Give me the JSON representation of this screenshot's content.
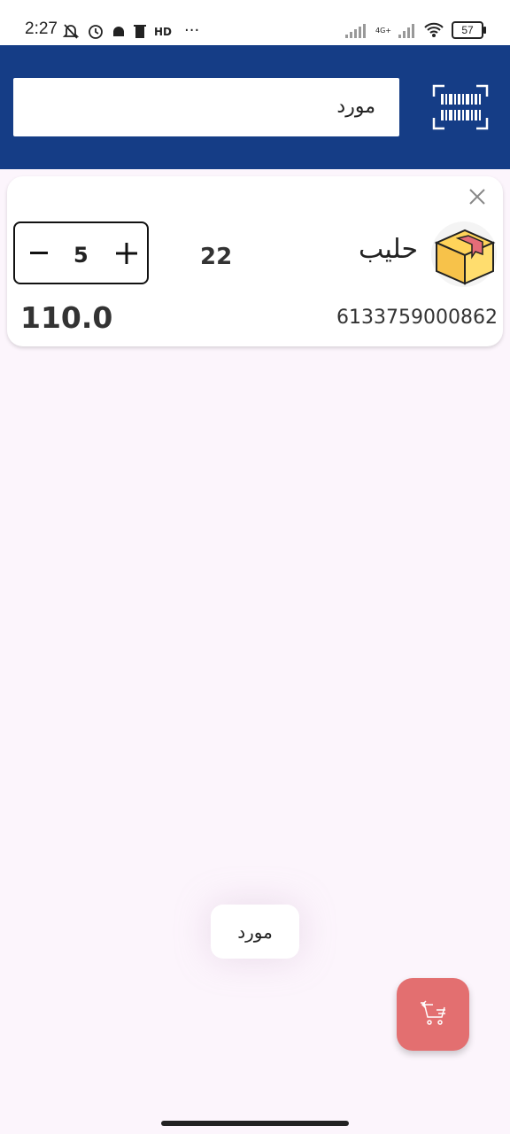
{
  "status_bar": {
    "time": "2:27",
    "dots": "···",
    "network": "4G+",
    "battery": "57"
  },
  "header": {
    "search_value": "مورد"
  },
  "product": {
    "name": "حليب",
    "stock": "22",
    "quantity": "5",
    "total": "110.0",
    "barcode": "6133759000862"
  },
  "supplier_chip": {
    "label": "مورد"
  },
  "colors": {
    "header_bg": "#153d86",
    "fab_bg": "#e36f70",
    "page_bg": "#fcf5fc"
  }
}
